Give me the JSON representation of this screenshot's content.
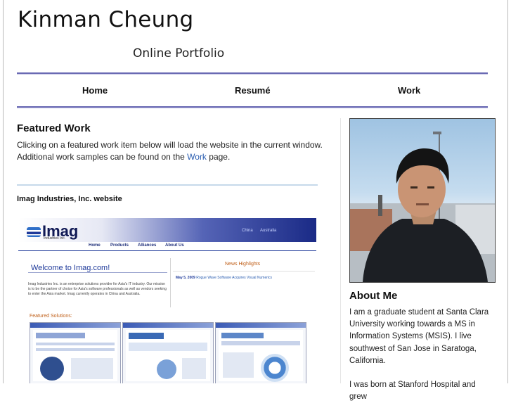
{
  "header": {
    "site_name": "Kinman Cheung",
    "tagline": "Online Portfolio"
  },
  "nav": {
    "home": "Home",
    "resume": "Resumé",
    "work": "Work"
  },
  "featured": {
    "heading": "Featured Work",
    "intro_before_link": "Clicking on a featured work item below will load the website in the current window. Additional work samples can be found on the ",
    "intro_link": "Work",
    "intro_after_link": " page.",
    "item_title": "Imag Industries, Inc. website"
  },
  "screenshot": {
    "logo_text": "Imag",
    "logo_sub": "Industries Inc.",
    "top_links": [
      "China",
      "Australia"
    ],
    "menu": [
      "Home",
      "Products",
      "Alliances",
      "About Us"
    ],
    "welcome": "Welcome to Imag.com!",
    "welcome_text": "Imag Industries Inc. is an enterprise solutions provider for Asia's IT industry. Our mission is to be the partner of choice for Asia's software professionals as well as vendors seeking to enter the Asia market. Imag currently operates in China and Australia.",
    "news_title": "News Highlights",
    "news_date": "May 5, 2009",
    "news_text": "Rogue Wave Software Acquires Visual Numerics",
    "featured_solutions": "Featured Solutions:"
  },
  "about": {
    "heading": "About Me",
    "paragraph1": "I am a graduate student at Santa Clara University working towards a MS in Information Systems (MSIS). I live southwest of San Jose in Saratoga, California.",
    "paragraph2": "I was born at Stanford Hospital and grew"
  },
  "colors": {
    "rule": "#6a6ab3",
    "link": "#2a5db0",
    "imag_blue": "#1f3a9a",
    "imag_orange": "#c0601a"
  }
}
